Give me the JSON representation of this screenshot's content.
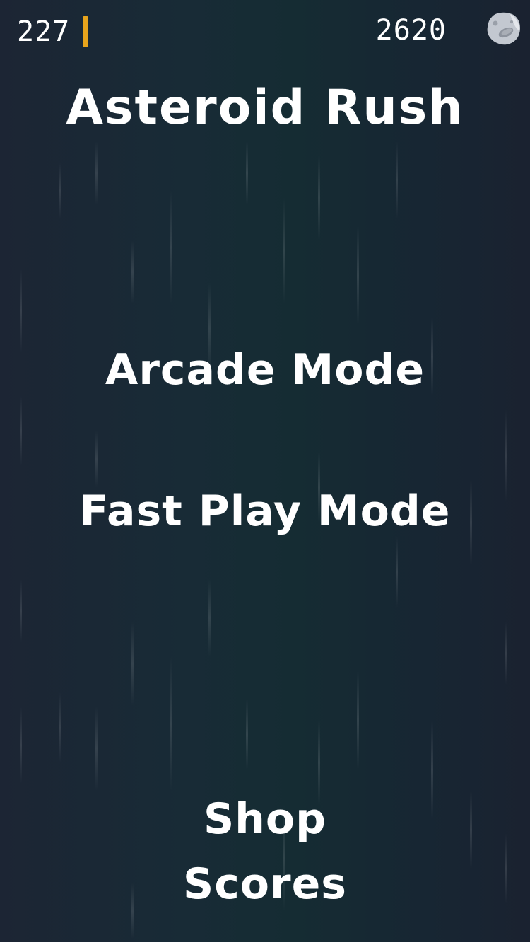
{
  "hud": {
    "asteroid_count": "227",
    "score": "2620",
    "fuel_color": "#e8a41c",
    "profile_icon": "asteroid-icon"
  },
  "title": "Asteroid Rush",
  "menu": {
    "arcade_label": "Arcade Mode",
    "fast_play_label": "Fast Play Mode",
    "shop_label": "Shop",
    "scores_label": "Scores"
  },
  "colors": {
    "background_dark": "#1c2534",
    "background_teal": "#152c33",
    "text": "#ffffff",
    "accent": "#e8a41c"
  }
}
